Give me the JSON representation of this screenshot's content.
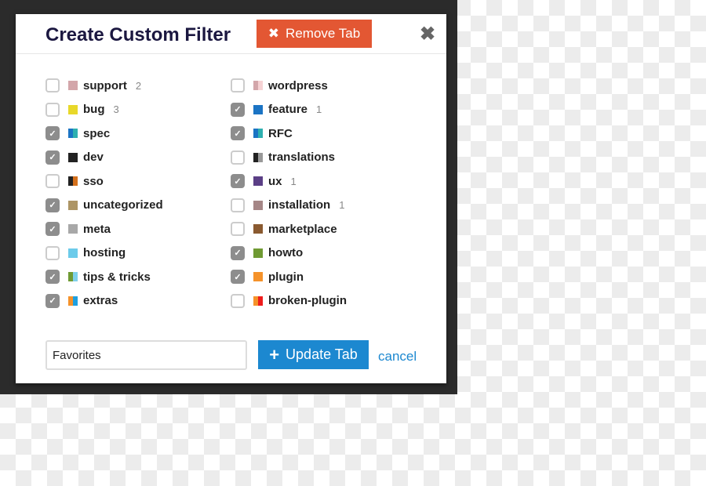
{
  "dialog": {
    "title": "Create Custom Filter",
    "remove_label": "Remove Tab",
    "remove_icon": "x-icon",
    "close_icon": "close-x-icon",
    "accent_remove": "#e35733",
    "accent_primary": "#1c88d0"
  },
  "filters_left": [
    {
      "label": "support",
      "count": "2",
      "checked": false,
      "colors": [
        "#d3a6aa"
      ]
    },
    {
      "label": "bug",
      "count": "3",
      "checked": false,
      "colors": [
        "#e8d82a"
      ]
    },
    {
      "label": "spec",
      "count": "",
      "checked": true,
      "colors": [
        "#1b74c4",
        "#2eb0b0"
      ]
    },
    {
      "label": "dev",
      "count": "",
      "checked": true,
      "colors": [
        "#222222"
      ]
    },
    {
      "label": "sso",
      "count": "",
      "checked": false,
      "colors": [
        "#222222",
        "#d4701c"
      ]
    },
    {
      "label": "uncategorized",
      "count": "",
      "checked": true,
      "colors": [
        "#ad9565"
      ]
    },
    {
      "label": "meta",
      "count": "",
      "checked": true,
      "colors": [
        "#a8a8a8"
      ]
    },
    {
      "label": "hosting",
      "count": "",
      "checked": false,
      "colors": [
        "#6ccbea"
      ]
    },
    {
      "label": "tips & tricks",
      "count": "",
      "checked": true,
      "colors": [
        "#6f9a33",
        "#7fd0ea"
      ]
    },
    {
      "label": "extras",
      "count": "",
      "checked": true,
      "colors": [
        "#f5922a",
        "#1ea0e0"
      ]
    }
  ],
  "filters_right": [
    {
      "label": "wordpress",
      "count": "",
      "checked": false,
      "colors": [
        "#d3a6aa",
        "#f6d2d4"
      ]
    },
    {
      "label": "feature",
      "count": "1",
      "checked": true,
      "colors": [
        "#1b74c4"
      ]
    },
    {
      "label": "RFC",
      "count": "",
      "checked": true,
      "colors": [
        "#1b74c4",
        "#2eb0b0"
      ]
    },
    {
      "label": "translations",
      "count": "",
      "checked": false,
      "colors": [
        "#222222",
        "#999999"
      ]
    },
    {
      "label": "ux",
      "count": "1",
      "checked": true,
      "colors": [
        "#5b3f86"
      ]
    },
    {
      "label": "installation",
      "count": "1",
      "checked": false,
      "colors": [
        "#a58686"
      ]
    },
    {
      "label": "marketplace",
      "count": "",
      "checked": false,
      "colors": [
        "#8a5a30"
      ]
    },
    {
      "label": "howto",
      "count": "",
      "checked": true,
      "colors": [
        "#6f9a33"
      ]
    },
    {
      "label": "plugin",
      "count": "",
      "checked": true,
      "colors": [
        "#f5922a"
      ]
    },
    {
      "label": "broken-plugin",
      "count": "",
      "checked": false,
      "colors": [
        "#f5922a",
        "#ee1c1c"
      ]
    }
  ],
  "footer": {
    "name_value": "Favorites",
    "update_label": "Update Tab",
    "update_icon": "plus-icon",
    "cancel_label": "cancel"
  }
}
